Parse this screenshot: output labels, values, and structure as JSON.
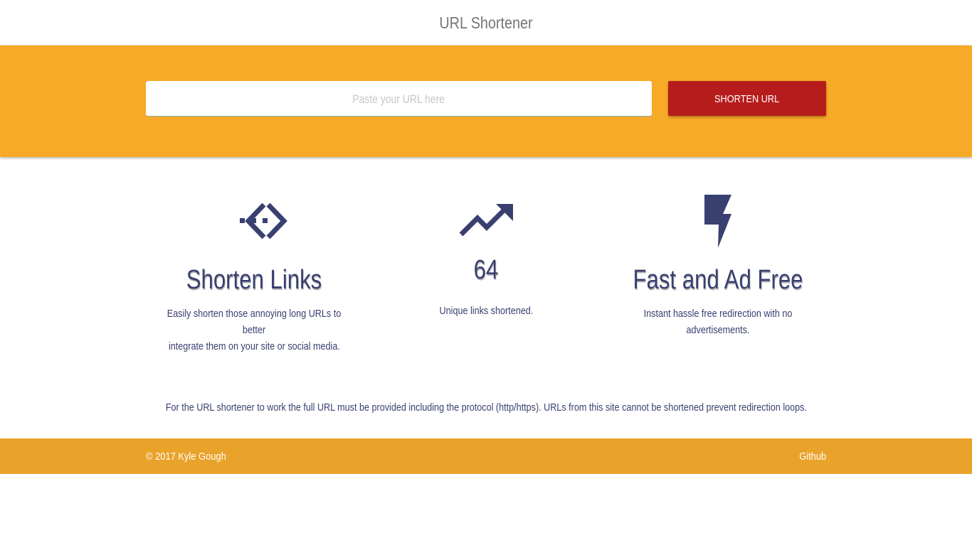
{
  "navbar": {
    "title": "URL Shortener"
  },
  "hero": {
    "input_placeholder": "Paste your URL here",
    "button_label": "SHORTEN URL"
  },
  "features": [
    {
      "icon": "code-arrows-icon",
      "title": "Shorten Links",
      "text_line1": "Easily shorten those annoying long URLs to better",
      "text_line2": "integrate them on your site or social media."
    },
    {
      "icon": "trending-up-icon",
      "title": "64",
      "text_line1": "Unique links shortened.",
      "text_line2": ""
    },
    {
      "icon": "lightning-bolt-icon",
      "title": "Fast and Ad Free",
      "text_line1": "Instant hassle free redirection with no advertisements.",
      "text_line2": ""
    }
  ],
  "note": "For the URL shortener to work the full URL must be provided including the protocol (http/https). URLs from this site cannot be shortened prevent redirection loops.",
  "footer": {
    "copyright": "© 2017 Kyle Gough",
    "github_label": "Github"
  },
  "colors": {
    "primary": "#f7a928",
    "footer": "#e9a22a",
    "button": "#b71c1c",
    "text": "#394070"
  }
}
